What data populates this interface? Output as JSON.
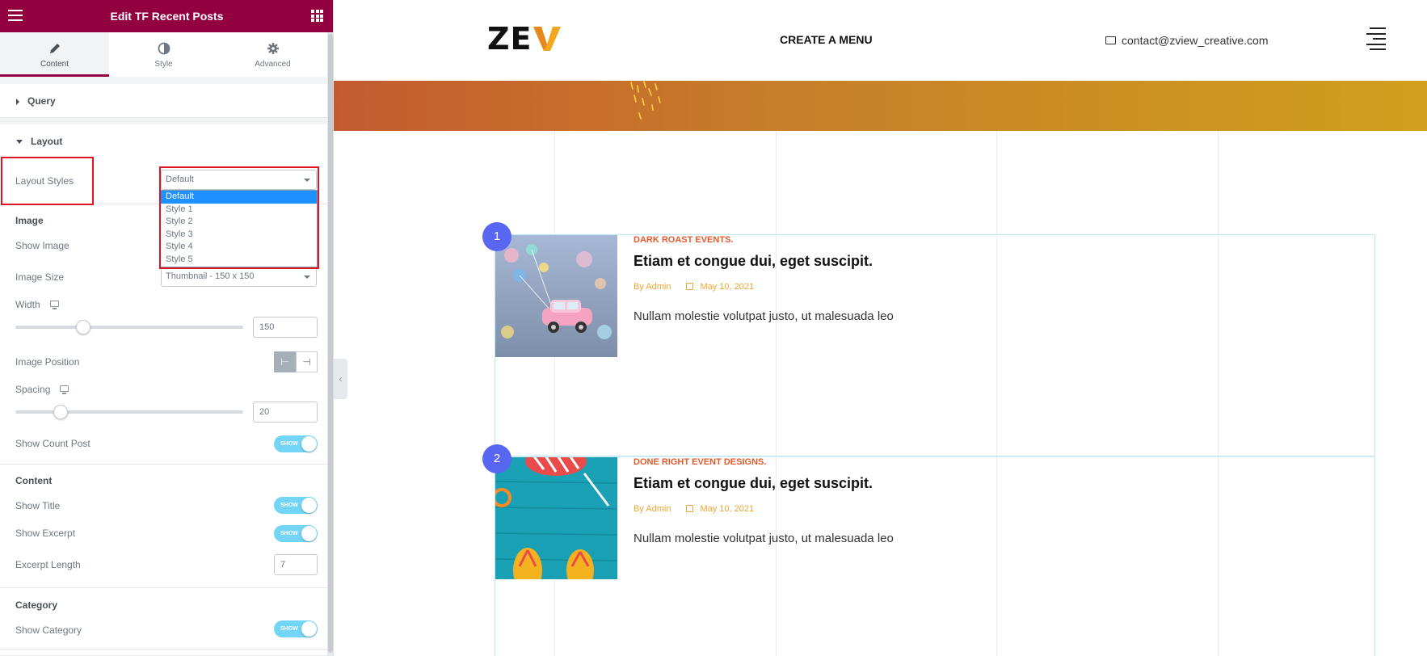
{
  "panel": {
    "header_title": "Edit TF Recent Posts",
    "tabs": [
      {
        "label": "Content",
        "icon": "pencil-icon",
        "active": true
      },
      {
        "label": "Style",
        "icon": "contrast-icon",
        "active": false
      },
      {
        "label": "Advanced",
        "icon": "gear-icon",
        "active": false
      }
    ],
    "query_label": "Query",
    "layout_label": "Layout",
    "layout_styles_label": "Layout Styles",
    "layout_styles_value": "Default",
    "layout_options": [
      "Default",
      "Style 1",
      "Style 2",
      "Style 3",
      "Style 4",
      "Style 5"
    ],
    "image_heading": "Image",
    "show_image_label": "Show Image",
    "image_size_label": "Image Size",
    "image_size_value": "Thumbnail - 150 x 150",
    "width_label": "Width",
    "width_value": "150",
    "image_position_label": "Image Position",
    "spacing_label": "Spacing",
    "spacing_value": "20",
    "show_count_post_label": "Show Count Post",
    "toggle_text": "SHOW",
    "content_heading": "Content",
    "show_title_label": "Show Title",
    "show_excerpt_label": "Show Excerpt",
    "excerpt_length_label": "Excerpt Length",
    "excerpt_length_value": "7",
    "category_heading": "Category",
    "show_category_label": "Show Category",
    "accent_color": "#93003f",
    "toggle_color": "#72d5f5"
  },
  "site": {
    "logo": "ZE",
    "nav_label": "CREATE A MENU",
    "contact_email": "contact@zview_creative.com",
    "posts": [
      {
        "number": "1",
        "category": "DARK ROAST EVENTS.",
        "title": "Etiam et congue dui, eget suscipit.",
        "author": "By Admin",
        "date": "May 10, 2021",
        "excerpt": "Nullam molestie volutpat justo, ut malesuada leo"
      },
      {
        "number": "2",
        "category": "DONE RIGHT EVENT DESIGNS.",
        "title": "Etiam et congue dui, eget suscipit.",
        "author": "By Admin",
        "date": "May 10, 2021",
        "excerpt": "Nullam molestie volutpat justo, ut malesuada leo"
      }
    ],
    "badge_color": "#5966f2",
    "category_color": "#e35a2a",
    "meta_color": "#f0a52c"
  }
}
